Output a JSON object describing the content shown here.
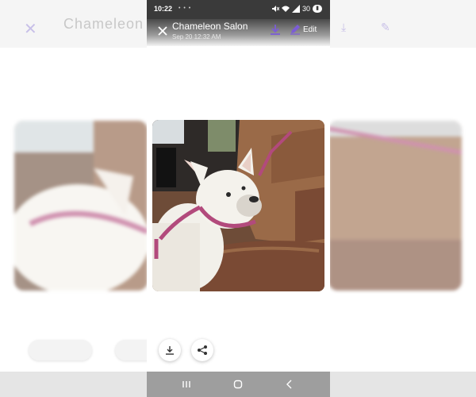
{
  "status_bar": {
    "time": "10:22",
    "notification_icons": "• • •",
    "battery": "30"
  },
  "header": {
    "title": "Chameleon Salon",
    "subtitle": "Sep 20 12:32 AM",
    "edit_label": "Edit"
  },
  "photo": {
    "subject": "white-french-bulldog-in-car",
    "colors": {
      "seat": "#8a5a3c",
      "harness": "#b24a7c",
      "dog": "#f2f0ea"
    }
  },
  "actions": {
    "download_icon": "download-icon",
    "share_icon": "share-icon"
  },
  "nav": {
    "recents": "recents-icon",
    "home": "home-icon",
    "back": "back-icon"
  },
  "colors": {
    "accent": "#7b5cd6",
    "status_bar": "#3a3a3a",
    "nav_bar": "#9e9e9e"
  }
}
